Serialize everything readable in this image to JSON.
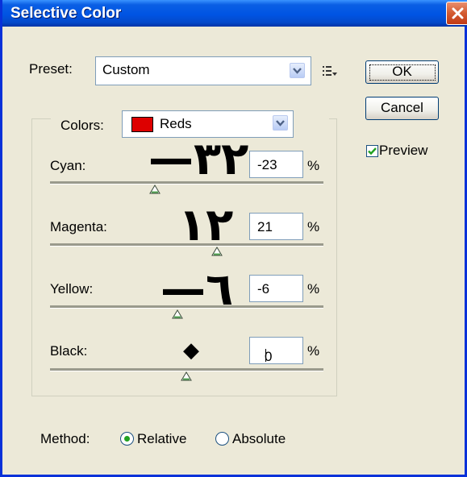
{
  "window": {
    "title": "Selective Color"
  },
  "preset": {
    "label": "Preset:",
    "value": "Custom"
  },
  "buttons": {
    "ok": "OK",
    "cancel": "Cancel"
  },
  "preview": {
    "label": "Preview",
    "checked": true
  },
  "colors": {
    "label": "Colors:",
    "value": "Reds",
    "swatch_color": "#dd0000"
  },
  "sliders": [
    {
      "label": "Cyan:",
      "value": "-23",
      "unit": "%",
      "annotation": "٢٣—"
    },
    {
      "label": "Magenta:",
      "value": "21",
      "unit": "%",
      "annotation": "٢١"
    },
    {
      "label": "Yellow:",
      "value": "-6",
      "unit": "%",
      "annotation": "٦—"
    },
    {
      "label": "Black:",
      "value": "0",
      "unit": "%",
      "annotation": "◆"
    }
  ],
  "method": {
    "label": "Method:",
    "options": [
      {
        "label": "Relative",
        "selected": true
      },
      {
        "label": "Absolute",
        "selected": false
      }
    ]
  },
  "icons": {
    "close": "close-icon",
    "dropdown": "chevron-down-icon",
    "menu": "list-menu-icon",
    "check": "check-icon",
    "slider_thumb": "triangle-up-icon"
  },
  "accent_colors": {
    "titlebar": "#0054e3",
    "close": "#c13a14",
    "radio_dot": "#21a121",
    "check": "#21a121"
  }
}
